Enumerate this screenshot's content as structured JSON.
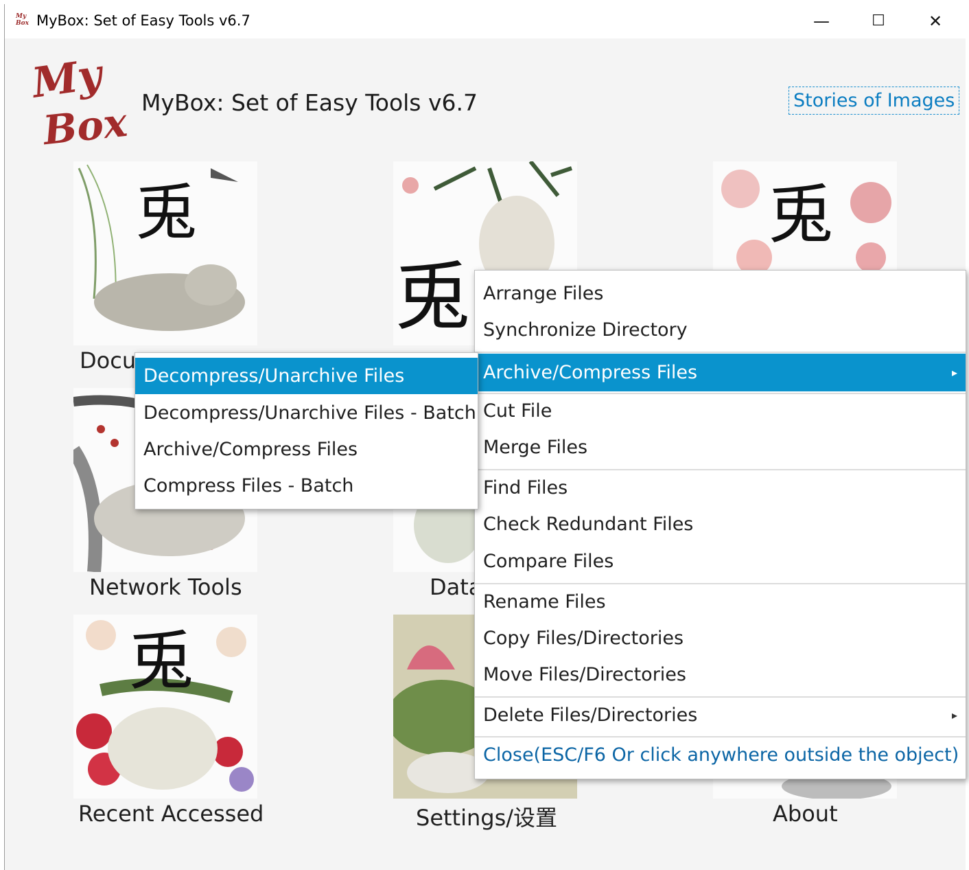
{
  "window": {
    "title": "MyBox: Set of Easy Tools v6.7",
    "icon_text_1": "My",
    "icon_text_2": "Box",
    "controls": {
      "minimize": "—",
      "maximize": "☐",
      "close": "✕"
    }
  },
  "header": {
    "logo_line1": "My",
    "logo_line2": "Box",
    "app_title": "MyBox: Set of Easy Tools v6.7",
    "stories_link": "Stories of Images"
  },
  "tiles": [
    {
      "label": "Docu",
      "glyph": "兎",
      "tone": "#7f9d68"
    },
    {
      "label": "",
      "glyph": "兎",
      "tone": "#5f7e4f"
    },
    {
      "label": "",
      "glyph": "兎",
      "tone": "#e5a8ad"
    },
    {
      "label": "Network Tools",
      "glyph": "",
      "tone": "#b3342f"
    },
    {
      "label": "Data",
      "glyph": "",
      "tone": "#8ea378"
    },
    {
      "label": "",
      "glyph": "",
      "tone": "#d6d6d6"
    },
    {
      "label": "Recent Accessed",
      "glyph": "兎",
      "tone": "#c8293a"
    },
    {
      "label": "Settings/设置",
      "glyph": "",
      "tone": "#d76b7e"
    },
    {
      "label": "About",
      "glyph": "",
      "tone": "#9a9a9a"
    }
  ],
  "file_menu": {
    "items": [
      "Arrange Files",
      "Synchronize Directory",
      "Archive/Compress Files",
      "Cut File",
      "Merge Files",
      "Find Files",
      "Check Redundant Files",
      "Compare Files",
      "Rename Files",
      "Copy Files/Directories",
      "Move Files/Directories",
      "Delete Files/Directories",
      "Close(ESC/F6 Or click anywhere outside the object)"
    ],
    "submenu_arrow": "▸"
  },
  "archive_submenu": {
    "items": [
      "Decompress/Unarchive Files",
      "Decompress/Unarchive Files - Batch",
      "Archive/Compress Files",
      "Compress Files - Batch"
    ]
  },
  "colors": {
    "selection": "#0a93cd",
    "link": "#0b7dc1",
    "logo": "#a12b2b"
  }
}
